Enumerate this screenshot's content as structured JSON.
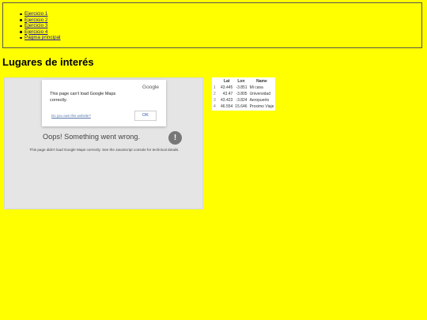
{
  "nav": {
    "items": [
      {
        "label": "Ejercicio 1"
      },
      {
        "label": "Ejercicio 2"
      },
      {
        "label": "Ejercicio 3"
      },
      {
        "label": "Ejercicio 4"
      },
      {
        "label": "Página principal"
      }
    ]
  },
  "page": {
    "title": "Lugares de interés"
  },
  "map": {
    "dialog": {
      "logo": "Google",
      "message": "This page can't load Google Maps correctly.",
      "own_link": "Do you own this website?",
      "ok_label": "OK"
    },
    "error_title": "Oops! Something went wrong.",
    "error_detail": "This page didn't load Google Maps correctly. See the JavaScript console for technical details.",
    "warning_icon": "exclamation-circle-icon"
  },
  "table": {
    "headers": [
      "",
      "Lat",
      "Lon",
      "Name"
    ],
    "rows": [
      {
        "idx": "1",
        "lat": "43.445",
        "lon": "-3.851",
        "name": "Mi casa"
      },
      {
        "idx": "2",
        "lat": "43.47",
        "lon": "-3.805",
        "name": "Universidad"
      },
      {
        "idx": "3",
        "lat": "43.423",
        "lon": "-3.824",
        "name": "Aeropuerto"
      },
      {
        "idx": "4",
        "lat": "46.554",
        "lon": "15.646",
        "name": "Proximo Viaje"
      }
    ]
  },
  "colors": {
    "background": "#ffff00",
    "link": "#1a0dab"
  }
}
